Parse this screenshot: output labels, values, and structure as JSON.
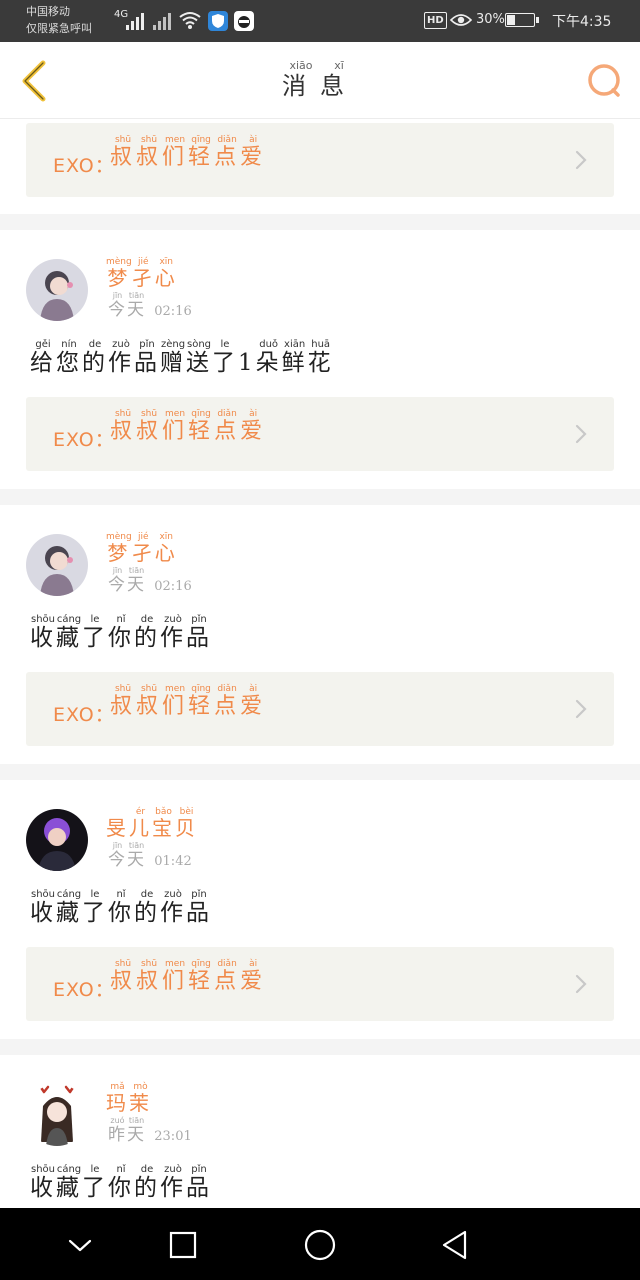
{
  "status_bar": {
    "carrier_line1": "中国移动",
    "carrier_line2": "仅限紧急呼叫",
    "network": "4G",
    "hd": "HD",
    "battery": "30%",
    "battery_level": 0.3,
    "time": "下午4:35"
  },
  "header": {
    "title": "消息",
    "title_ruby": [
      {
        "c": "消",
        "p": "xiāo"
      },
      {
        "c": "息",
        "p": "xī"
      }
    ]
  },
  "work": {
    "prefix": "EXO：",
    "title_ruby": [
      {
        "c": "叔",
        "p": "shū"
      },
      {
        "c": "叔",
        "p": "shū"
      },
      {
        "c": "们",
        "p": "men"
      },
      {
        "c": "轻",
        "p": "qīng"
      },
      {
        "c": "点",
        "p": "diǎn"
      },
      {
        "c": "爱",
        "p": "ài"
      }
    ]
  },
  "messages": [
    {
      "name": "梦孑心",
      "name_ruby": [
        {
          "c": "梦",
          "p": "mèng"
        },
        {
          "c": "孑",
          "p": "jié"
        },
        {
          "c": "心",
          "p": "xīn"
        }
      ],
      "day": "今天",
      "day_ruby": [
        {
          "c": "今",
          "p": "jīn"
        },
        {
          "c": "天",
          "p": "tiān"
        }
      ],
      "time": "02:16",
      "text": "给您的作品赠送了1朵鲜花",
      "text_ruby": [
        {
          "c": "给",
          "p": "gěi"
        },
        {
          "c": "您",
          "p": "nín"
        },
        {
          "c": "的",
          "p": "de"
        },
        {
          "c": "作",
          "p": "zuò"
        },
        {
          "c": "品",
          "p": "pǐn"
        },
        {
          "c": "赠",
          "p": "zèng"
        },
        {
          "c": "送",
          "p": "sòng"
        },
        {
          "c": "了",
          "p": "le"
        },
        {
          "c": "1",
          "p": ""
        },
        {
          "c": "朵",
          "p": "duǒ"
        },
        {
          "c": "鲜",
          "p": "xiān"
        },
        {
          "c": "花",
          "p": "huā"
        }
      ],
      "avatar": "girl-light"
    },
    {
      "name": "梦孑心",
      "name_ruby": [
        {
          "c": "梦",
          "p": "mèng"
        },
        {
          "c": "孑",
          "p": "jié"
        },
        {
          "c": "心",
          "p": "xīn"
        }
      ],
      "day": "今天",
      "day_ruby": [
        {
          "c": "今",
          "p": "jīn"
        },
        {
          "c": "天",
          "p": "tiān"
        }
      ],
      "time": "02:16",
      "text": "收藏了你的作品",
      "text_ruby": [
        {
          "c": "收",
          "p": "shōu"
        },
        {
          "c": "藏",
          "p": "cáng"
        },
        {
          "c": "了",
          "p": "le"
        },
        {
          "c": "你",
          "p": "nǐ"
        },
        {
          "c": "的",
          "p": "de"
        },
        {
          "c": "作",
          "p": "zuò"
        },
        {
          "c": "品",
          "p": "pǐn"
        }
      ],
      "avatar": "girl-light"
    },
    {
      "name": "旻儿宝贝",
      "name_ruby": [
        {
          "c": "旻",
          "p": ""
        },
        {
          "c": "儿",
          "p": "ér"
        },
        {
          "c": "宝",
          "p": "bǎo"
        },
        {
          "c": "贝",
          "p": "bèi"
        }
      ],
      "day": "今天",
      "day_ruby": [
        {
          "c": "今",
          "p": "jīn"
        },
        {
          "c": "天",
          "p": "tiān"
        }
      ],
      "time": "01:42",
      "text": "收藏了你的作品",
      "text_ruby": [
        {
          "c": "收",
          "p": "shōu"
        },
        {
          "c": "藏",
          "p": "cáng"
        },
        {
          "c": "了",
          "p": "le"
        },
        {
          "c": "你",
          "p": "nǐ"
        },
        {
          "c": "的",
          "p": "de"
        },
        {
          "c": "作",
          "p": "zuò"
        },
        {
          "c": "品",
          "p": "pǐn"
        }
      ],
      "avatar": "boy-dark"
    },
    {
      "name": "玛茉",
      "name_ruby": [
        {
          "c": "玛",
          "p": "mǎ"
        },
        {
          "c": "茉",
          "p": "mò"
        }
      ],
      "day": "昨天",
      "day_ruby": [
        {
          "c": "昨",
          "p": "zuó"
        },
        {
          "c": "天",
          "p": "tiān"
        }
      ],
      "time": "23:01",
      "text": "收藏了你的作品",
      "text_ruby": [
        {
          "c": "收",
          "p": "shōu"
        },
        {
          "c": "藏",
          "p": "cáng"
        },
        {
          "c": "了",
          "p": "le"
        },
        {
          "c": "你",
          "p": "nǐ"
        },
        {
          "c": "的",
          "p": "de"
        },
        {
          "c": "作",
          "p": "zuò"
        },
        {
          "c": "品",
          "p": "pǐn"
        }
      ],
      "avatar": "girl-antlers"
    }
  ],
  "icons": {
    "back": "chevron-left-icon",
    "search": "search-icon",
    "card_arrow": "chevron-right-icon",
    "nav": [
      "chevron-down-icon",
      "square-icon",
      "circle-icon",
      "triangle-back-icon"
    ]
  },
  "colors": {
    "accent": "#f08a4a",
    "back_icon": "#f0c23a",
    "card_bg": "#f3f3ee",
    "separator": "#f4f4f4"
  }
}
